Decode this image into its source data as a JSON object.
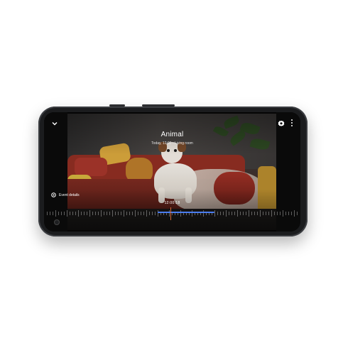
{
  "header": {
    "back_icon": "chevron-down-icon",
    "settings_icon": "gear-icon",
    "menu_icon": "more-vert-icon"
  },
  "event": {
    "title": "Animal",
    "subtitle": "Today, 12:00 • Living room"
  },
  "footer": {
    "event_details_label": "Event details",
    "event_details_icon": "settings-icon",
    "timestamp": "12:00:18"
  },
  "colors": {
    "progress": "#4a7cf0",
    "playhead": "#d66a3a",
    "screen_bg": "#050505"
  }
}
